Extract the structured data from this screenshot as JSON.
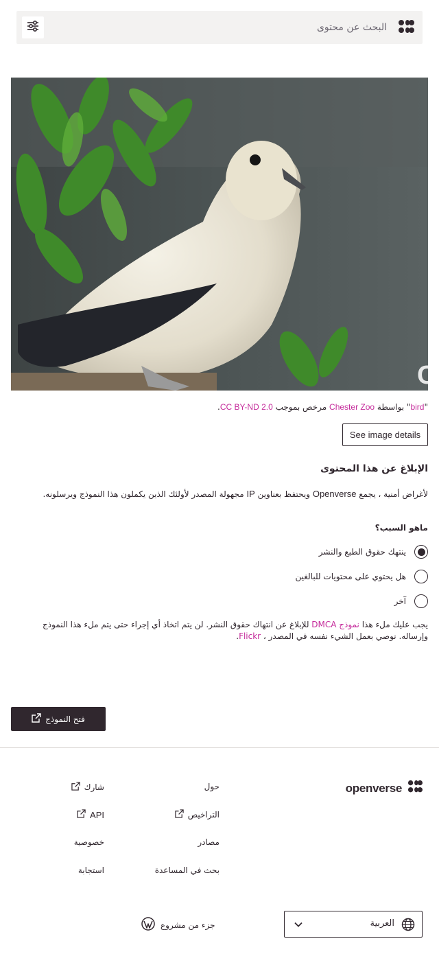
{
  "header": {
    "search_placeholder": "البحث عن محتوى",
    "logo_icon": "openverse-logo-icon",
    "filter_icon": "sliders-icon"
  },
  "image": {
    "watermark": "ChesterZoo.org"
  },
  "attribution": {
    "quote_open": "\"",
    "title": "bird",
    "quote_close": "\"",
    "by": " بواسطة ",
    "author": "Chester Zoo",
    "licensed": " مرخص بموجب ",
    "license": "CC BY-ND 2.0",
    "end": "."
  },
  "details_button": "See image details",
  "report": {
    "title": "الإبلاغ عن هذا المحتوى",
    "desc_part1": "لأغراض أمنية ، يجمع ",
    "desc_brand": "Openverse",
    "desc_part2": " ويحتفظ بعناوين ",
    "desc_ip": "IP",
    "desc_part3": " مجهولة المصدر لأولئك الذين يكملون هذا النموذج ويرسلونه.",
    "reason_question": "ماهو السبب؟",
    "options": [
      {
        "label": "ينتهك حقوق الطبع والنشر",
        "checked": true
      },
      {
        "label": "هل يحتوي على محتويات للبالغين",
        "checked": false
      },
      {
        "label": "آخر",
        "checked": false
      }
    ],
    "dmca_part1": "يجب عليك ملء هذا ",
    "dmca_link": "نموذج DMCA",
    "dmca_part2": " للإبلاغ عن انتهاك حقوق النشر. لن يتم اتخاذ أي إجراء حتى يتم ملء هذا النموذج وإرساله. نوصي بعمل الشيء نفسه في المصدر ، ",
    "dmca_source": "Flickr",
    "dmca_end": ".",
    "open_form_button": "فتح النموذج"
  },
  "footer": {
    "logo_text": "openverse",
    "links": {
      "about": "حول",
      "share": "شارك",
      "licenses": "التراخيص",
      "api": "API",
      "sources": "مصادر",
      "privacy": "خصوصية",
      "search_help": "بحث في المساعدة",
      "feedback": "استجابة"
    },
    "part_of": "جزء من مشروع",
    "language": "العربية"
  },
  "colors": {
    "accent": "#c52b9b",
    "dark": "#30272e",
    "search_bg": "#f3f2f1"
  }
}
